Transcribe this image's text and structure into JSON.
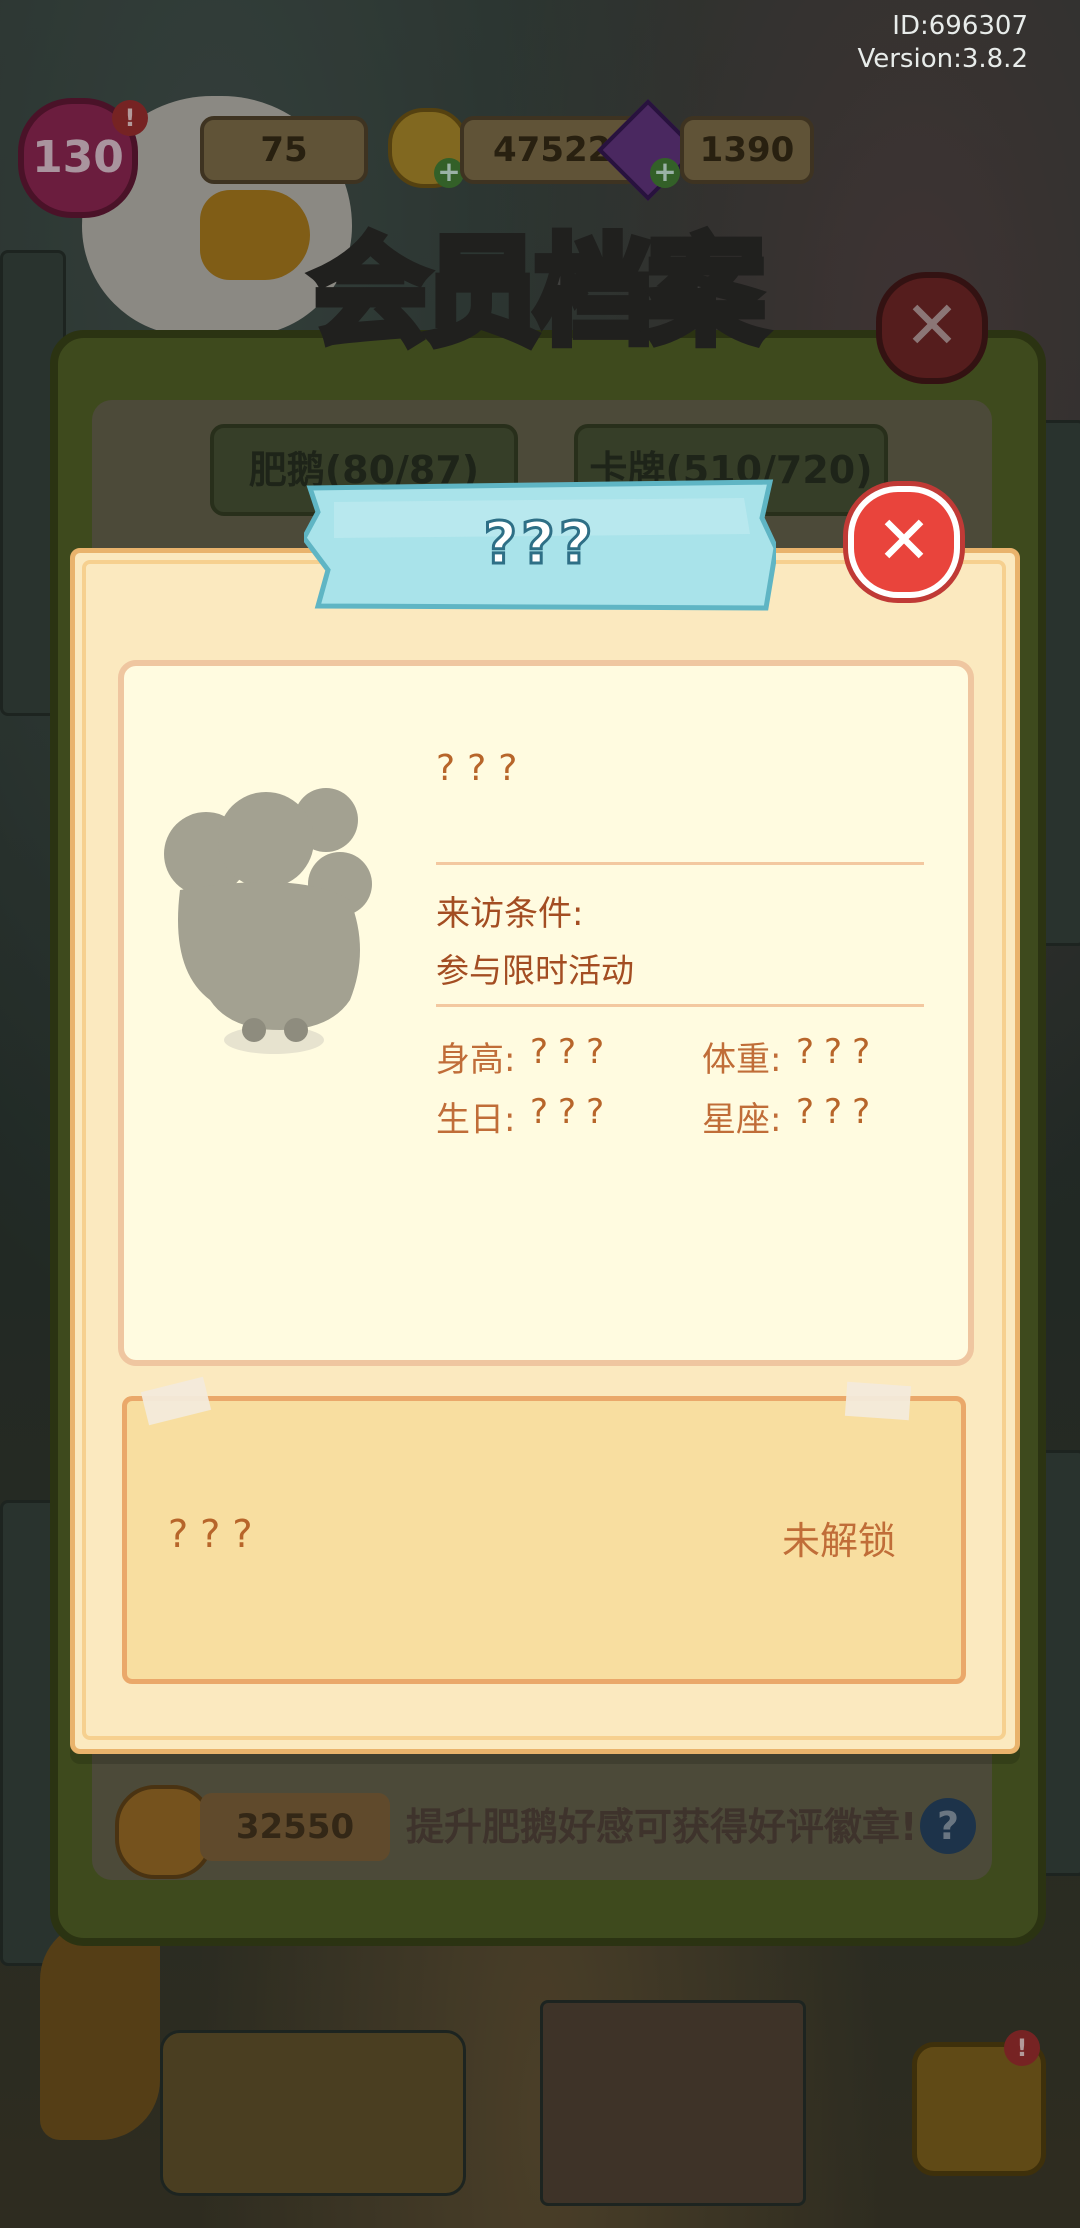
{
  "system": {
    "id": "ID:696307",
    "version": "Version:3.8.2"
  },
  "topbar": {
    "level": "130",
    "slot1": "75",
    "coins": "475222",
    "gems": "1390"
  },
  "archive": {
    "title": "会员档案",
    "tab1": "肥鹅(80/87)",
    "tab2": "卡牌(510/720)",
    "heart_value": "32550",
    "tip": "提升肥鹅好感可获得好评徽章!",
    "help": "?"
  },
  "card": {
    "banner_title": "???",
    "name": "???",
    "visit_label": "来访条件:",
    "visit_value": "参与限时活动",
    "height_label": "身高:",
    "height_value": "???",
    "weight_label": "体重:",
    "weight_value": "???",
    "birthday_label": "生日:",
    "birthday_value": "???",
    "sign_label": "星座:",
    "sign_value": "???",
    "lock_item": "???",
    "lock_status": "未解锁"
  },
  "icons": {
    "close": "✕",
    "plus": "+",
    "alert": "!"
  },
  "colors": {
    "close_red": "#e9443c",
    "banner_teal": "#a9e3ea",
    "paper": "#fbe9bf",
    "text_brown": "#b7652a"
  }
}
